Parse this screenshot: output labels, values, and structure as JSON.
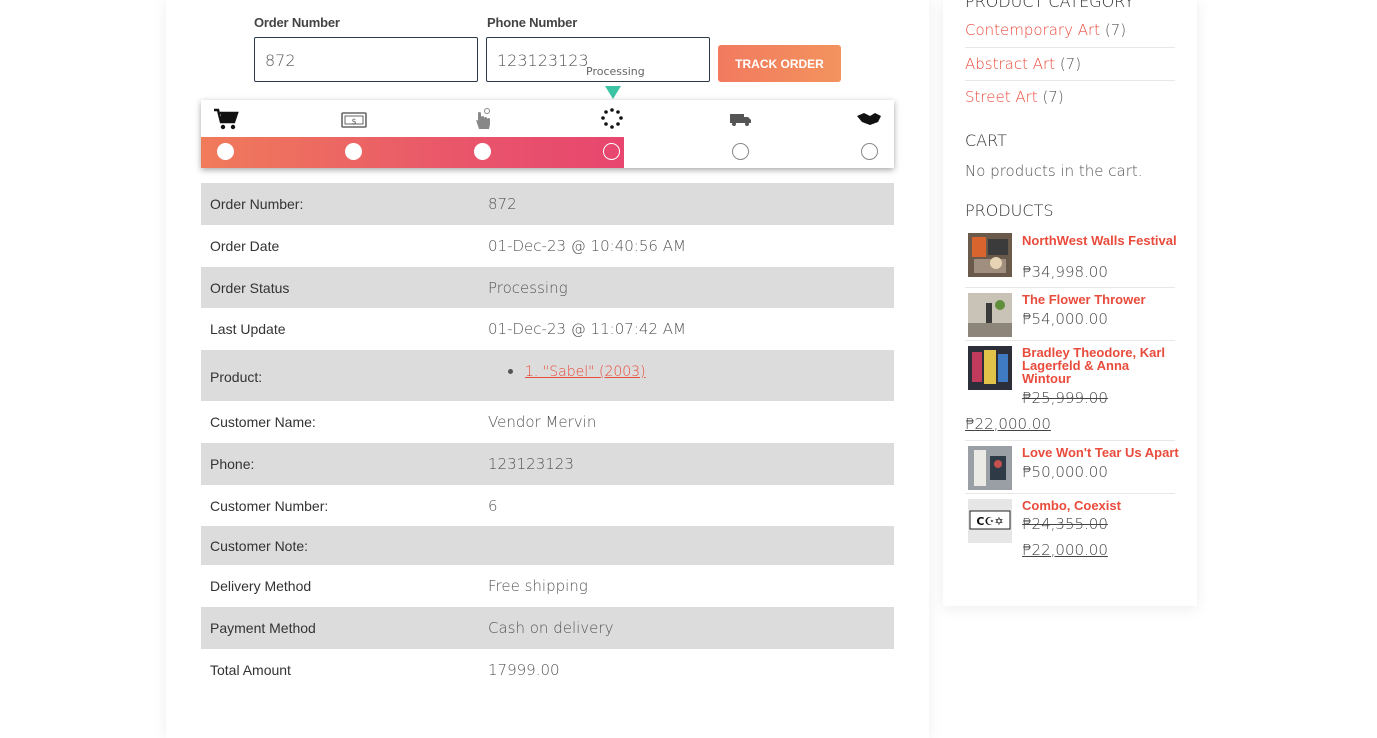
{
  "form": {
    "order_number_label": "Order Number",
    "order_number_value": "872",
    "phone_label": "Phone Number",
    "phone_value": "123123123",
    "processing_hint": "Processing",
    "track_button": "TRACK ORDER"
  },
  "tracker": {
    "progress_fraction": 0.61,
    "current_step": 4,
    "steps": [
      {
        "icon": "cart-icon",
        "state": "done"
      },
      {
        "icon": "cash-icon",
        "state": "done"
      },
      {
        "icon": "hand-pointer-icon",
        "state": "done"
      },
      {
        "icon": "spinner-icon",
        "state": "current"
      },
      {
        "icon": "truck-icon",
        "state": "pending"
      },
      {
        "icon": "handshake-icon",
        "state": "pending"
      }
    ]
  },
  "details": {
    "rows": [
      {
        "label": "Order Number:",
        "value": "872"
      },
      {
        "label": "Order Date",
        "value": "01-Dec-23 @ 10:40:56 AM"
      },
      {
        "label": "Order Status",
        "value": "Processing"
      },
      {
        "label": "Last Update",
        "value": "01-Dec-23 @ 11:07:42 AM"
      },
      {
        "label": "Product:",
        "value": "1. \"Sabel\" (2003)"
      },
      {
        "label": "Customer Name:",
        "value": "Vendor Mervin"
      },
      {
        "label": "Phone:",
        "value": "123123123"
      },
      {
        "label": "Customer Number:",
        "value": "6"
      },
      {
        "label": "Customer Note:",
        "value": ""
      },
      {
        "label": "Delivery Method",
        "value": "Free shipping"
      },
      {
        "label": "Payment Method",
        "value": "Cash on delivery"
      },
      {
        "label": "Total Amount",
        "value": "17999.00"
      }
    ]
  },
  "sidebar": {
    "category_heading": "PRODUCT CATEGORY",
    "categories": [
      {
        "name": "Contemporary Art",
        "count": "(7)"
      },
      {
        "name": "Abstract Art",
        "count": "(7)"
      },
      {
        "name": "Street Art",
        "count": "(7)"
      }
    ],
    "cart_heading": "CART",
    "cart_empty": "No products in the cart.",
    "products_heading": "PRODUCTS",
    "products": [
      {
        "title": "NorthWest Walls Festival",
        "price": "₱34,998.00"
      },
      {
        "title": "The Flower Thrower",
        "price": "₱54,000.00"
      },
      {
        "title": "Bradley Theodore, Karl Lagerfeld & Anna Wintour",
        "old_price": "₱25,999.00",
        "price": "₱22,000.00"
      },
      {
        "title": "Love Won't Tear Us Apart",
        "price": "₱50,000.00"
      },
      {
        "title": "Combo, Coexist",
        "old_price": "₱24,355.00",
        "price": "₱22,000.00"
      }
    ]
  },
  "colors": {
    "accent": "#e94b3c",
    "button": "#f27a5f",
    "pointer": "#3cc4a4",
    "row_shade": "#dcdcdc"
  }
}
